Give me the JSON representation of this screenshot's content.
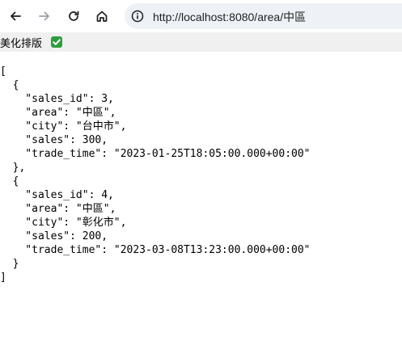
{
  "browser": {
    "url": "http://localhost:8080/area/中區"
  },
  "prettify": {
    "label": "美化排版",
    "checked": true
  },
  "json_lines": [
    "[",
    "  {",
    "    \"sales_id\": 3,",
    "    \"area\": \"中區\",",
    "    \"city\": \"台中市\",",
    "    \"sales\": 300,",
    "    \"trade_time\": \"2023-01-25T18:05:00.000+00:00\"",
    "  },",
    "  {",
    "    \"sales_id\": 4,",
    "    \"area\": \"中區\",",
    "    \"city\": \"彰化市\",",
    "    \"sales\": 200,",
    "    \"trade_time\": \"2023-03-08T13:23:00.000+00:00\"",
    "  }",
    "]"
  ],
  "icons": {
    "back": "arrow-left-icon",
    "forward": "arrow-right-icon",
    "reload": "reload-icon",
    "home": "home-icon",
    "site_info": "info-icon",
    "checkbox": "checkmark-icon"
  },
  "colors": {
    "checkbox": "#2e9e3f",
    "omnibox": "#eef1f6",
    "prettify_bar": "#f0f0f0"
  }
}
